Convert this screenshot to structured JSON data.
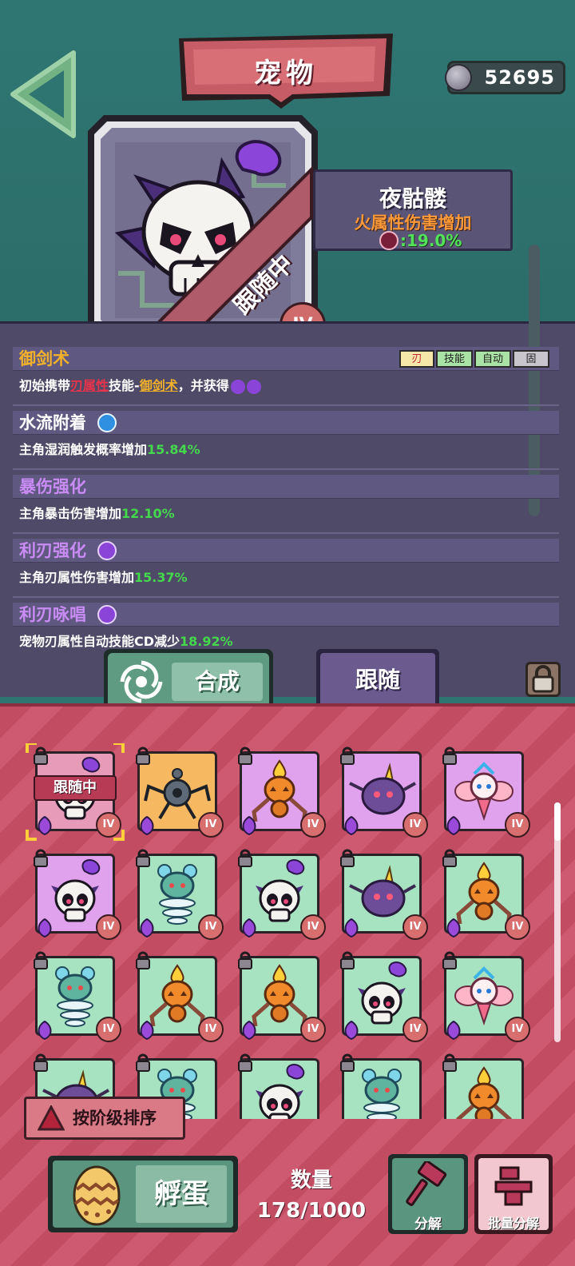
{
  "header": {
    "title": "宠物",
    "coins": "52695"
  },
  "pet": {
    "name": "夜骷髅",
    "bonus_text": "火属性伤害增加",
    "bonus_value": ":19.0%",
    "status_ribbon": "跟随中",
    "rank": "IV"
  },
  "skills": [
    {
      "name": "御剑术",
      "name_color": "#f3b12b",
      "desc_parts": [
        "初始携带",
        "刃属性",
        "技能-",
        "御剑术",
        "，并获得"
      ],
      "tags": [
        "刃",
        "技能",
        "自动",
        "固"
      ]
    },
    {
      "name": "水流附着",
      "name_color": "#ffffff",
      "desc": "主角湿润触发概率增加",
      "value": "15.84%"
    },
    {
      "name": "暴伤强化",
      "name_color": "#c98cf5",
      "desc": "主角暴击伤害增加",
      "value": "12.10%"
    },
    {
      "name": "利刃强化",
      "name_color": "#c98cf5",
      "desc": "主角刃属性伤害增加",
      "value": "15.37%"
    },
    {
      "name": "利刃咏唱",
      "name_color": "#c98cf5",
      "desc": "宠物刃属性自动技能CD减少",
      "value": "18.92%"
    }
  ],
  "actions": {
    "combine": "合成",
    "follow": "跟随"
  },
  "grid": {
    "following_tag": "跟随中",
    "level_label": "IV",
    "cards": [
      {
        "pet": "skull",
        "bg": "#e79bb8",
        "following": true,
        "selected": true
      },
      {
        "pet": "spider-bot",
        "bg": "#f6b860"
      },
      {
        "pet": "pumpkin",
        "bg": "#e0a2ec"
      },
      {
        "pet": "horn-blob",
        "bg": "#e0a2ec"
      },
      {
        "pet": "fairy",
        "bg": "#e0a2ec"
      },
      {
        "pet": "skull",
        "bg": "#e0a2ec"
      },
      {
        "pet": "water-spirit",
        "bg": "#a7e2c1"
      },
      {
        "pet": "skull",
        "bg": "#a7e2c1"
      },
      {
        "pet": "horn-blob",
        "bg": "#a7e2c1"
      },
      {
        "pet": "pumpkin",
        "bg": "#a7e2c1"
      },
      {
        "pet": "water-spirit",
        "bg": "#a7e2c1"
      },
      {
        "pet": "pumpkin",
        "bg": "#a7e2c1"
      },
      {
        "pet": "pumpkin",
        "bg": "#a7e2c1"
      },
      {
        "pet": "skull",
        "bg": "#a7e2c1"
      },
      {
        "pet": "fairy",
        "bg": "#a7e2c1"
      },
      {
        "pet": "horn-blob",
        "bg": "#a7e2c1"
      },
      {
        "pet": "water-spirit",
        "bg": "#a7e2c1"
      },
      {
        "pet": "skull",
        "bg": "#a7e2c1"
      },
      {
        "pet": "water-spirit",
        "bg": "#a7e2c1"
      },
      {
        "pet": "pumpkin",
        "bg": "#a7e2c1"
      }
    ]
  },
  "footer": {
    "sort_label": "按阶级排序",
    "hatch_label": "孵蛋",
    "quantity_label": "数量",
    "quantity_value": "178/1000",
    "decompose_label": "分解",
    "batch_decompose_label": "批量分解"
  },
  "colors": {
    "top_bg": "#2e7470",
    "panel_bg": "#4f4a67",
    "grid_bg": "#c24d63",
    "green_value": "#44d84c",
    "orange_bonus": "#ff9a3a"
  }
}
